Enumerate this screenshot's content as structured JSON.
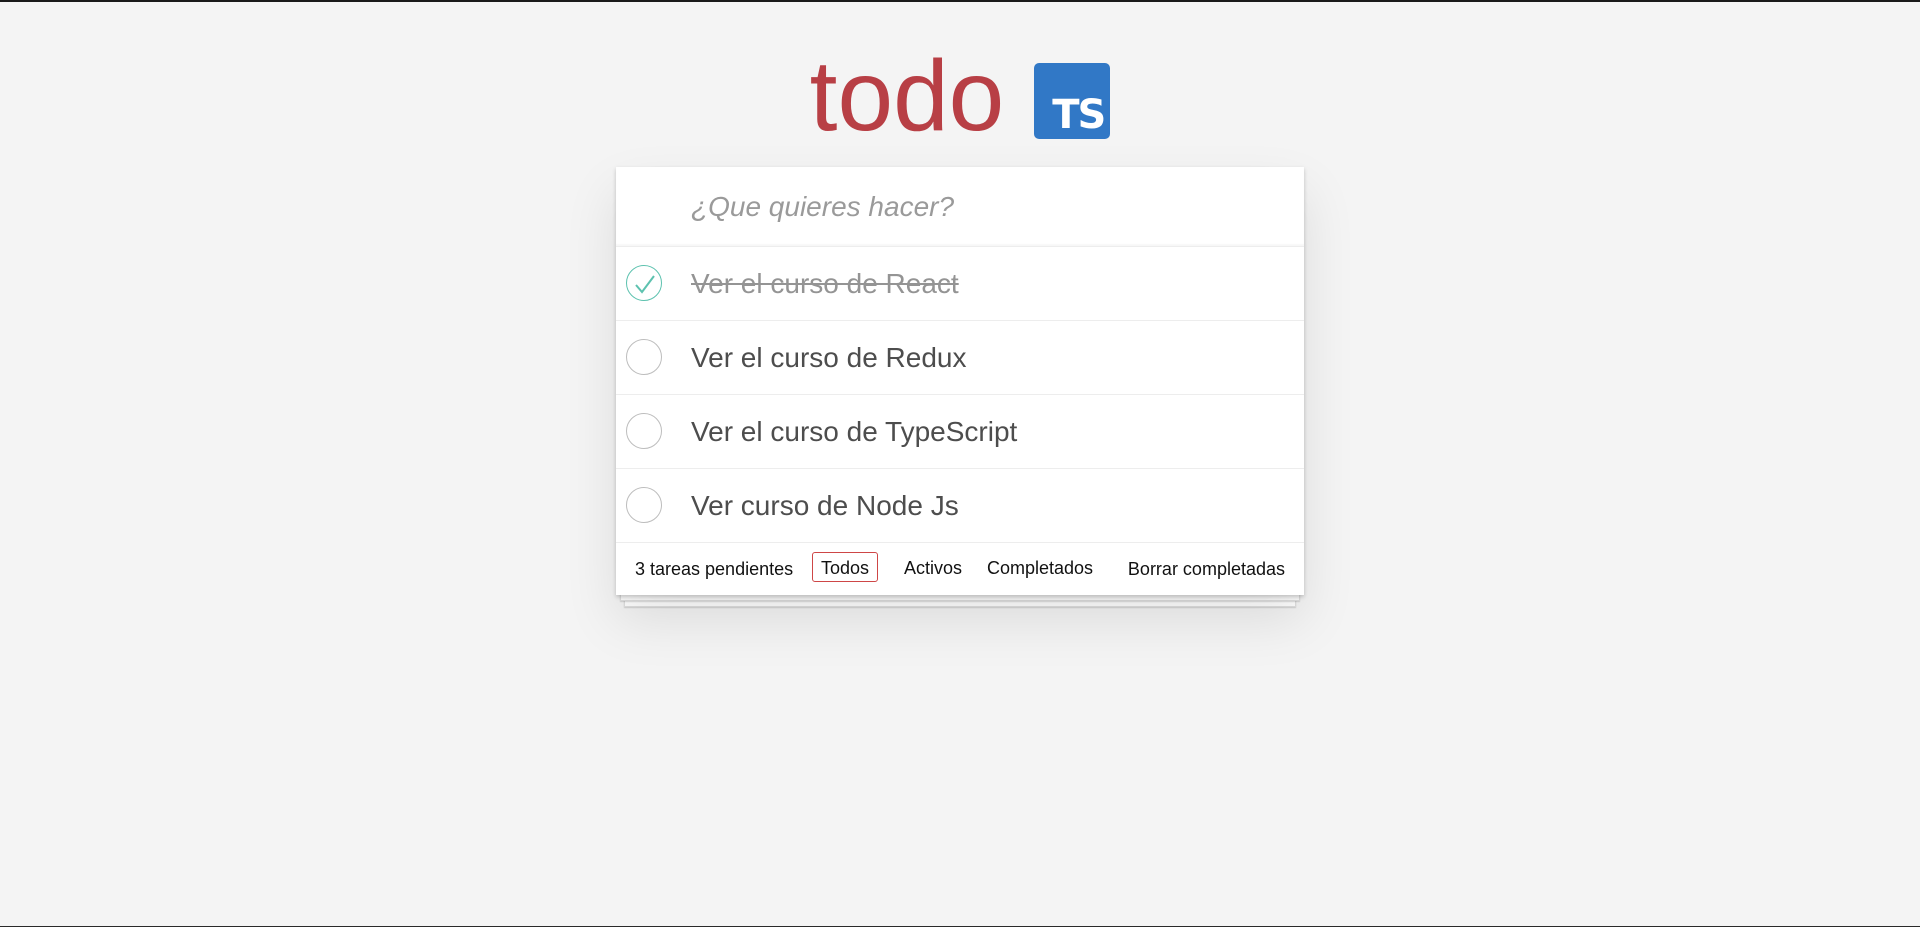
{
  "header": {
    "title": "todo",
    "logo_text": "TS"
  },
  "new_todo": {
    "placeholder": "¿Que quieres hacer?",
    "value": ""
  },
  "todos": [
    {
      "label": "Ver el curso de React",
      "completed": true
    },
    {
      "label": "Ver el curso de Redux",
      "completed": false
    },
    {
      "label": "Ver el curso de TypeScript",
      "completed": false
    },
    {
      "label": "Ver curso de Node Js",
      "completed": false
    }
  ],
  "footer": {
    "count_label": "3 tareas pendientes",
    "filters": [
      {
        "label": "Todos",
        "selected": true
      },
      {
        "label": "Activos",
        "selected": false
      },
      {
        "label": "Completados",
        "selected": false
      }
    ],
    "clear_label": "Borrar completadas"
  },
  "colors": {
    "title": "#b83f45",
    "logo_bg": "#3178c6",
    "check": "#5dc2af",
    "selected_filter_border": "#ce4646",
    "background": "#f4f4f4"
  },
  "icons": {
    "checked_toggle": "check-icon"
  }
}
